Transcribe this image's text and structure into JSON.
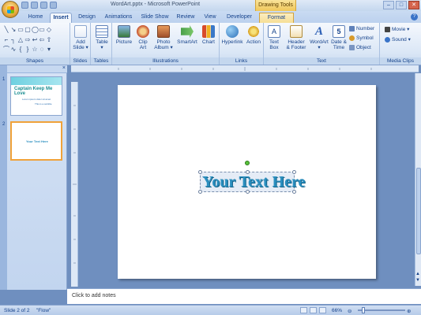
{
  "window": {
    "title": "WordArt.pptx - Microsoft PowerPoint",
    "context_tab_label": "Drawing Tools",
    "controls": {
      "minimize": "–",
      "maximize": "□",
      "close": "✕"
    }
  },
  "tabs": [
    {
      "label": "Home",
      "active": false
    },
    {
      "label": "Insert",
      "active": true
    },
    {
      "label": "Design",
      "active": false
    },
    {
      "label": "Animations",
      "active": false
    },
    {
      "label": "Slide Show",
      "active": false
    },
    {
      "label": "Review",
      "active": false
    },
    {
      "label": "View",
      "active": false
    },
    {
      "label": "Developer",
      "active": false
    },
    {
      "label": "Format",
      "active": false,
      "context": true
    }
  ],
  "ribbon": {
    "groups": {
      "shapes": "Shapes",
      "slides": "Slides",
      "tables": "Tables",
      "illustrations": "Illustrations",
      "links": "Links",
      "text": "Text",
      "media_clips": "Media Clips"
    },
    "buttons": {
      "add_slide_1": "Add",
      "add_slide_2": "Slide ▾",
      "table_1": "Table",
      "table_2": "▾",
      "picture": "Picture",
      "clip_art_1": "Clip",
      "clip_art_2": "Art",
      "photo_album_1": "Photo",
      "photo_album_2": "Album ▾",
      "smartart": "SmartArt",
      "chart": "Chart",
      "hyperlink": "Hyperlink",
      "action": "Action",
      "text_box_1": "Text",
      "text_box_2": "Box",
      "header_footer_1": "Header",
      "header_footer_2": "& Footer",
      "wordart_1": "WordArt",
      "wordart_2": "▾",
      "date_time_1": "Date &",
      "date_time_2": "Time",
      "slide_number_digit": "5",
      "number": "Number",
      "symbol": "Symbol",
      "object": "Object",
      "movie": "Movie ▾",
      "sound": "Sound ▾"
    }
  },
  "slide_panel": {
    "slides": [
      {
        "number": "1",
        "title": "Captain Keep Me Love",
        "subtitle_1": "Lorem ipsum dolor sit amet",
        "subtitle_2": "This is a subtitle"
      },
      {
        "number": "2",
        "title": "Your Text Here"
      }
    ],
    "close_label": "×"
  },
  "slide": {
    "wordart_text": "Your Text Here"
  },
  "notes": {
    "placeholder": "Click to add notes"
  },
  "status": {
    "slide_position": "Slide 2 of 2",
    "theme": "\"Flow\"",
    "zoom": "66%"
  },
  "colors": {
    "wordart": "#2b8fbf",
    "ribbon_accent": "#15428b",
    "context_tab": "#f0c75a"
  }
}
